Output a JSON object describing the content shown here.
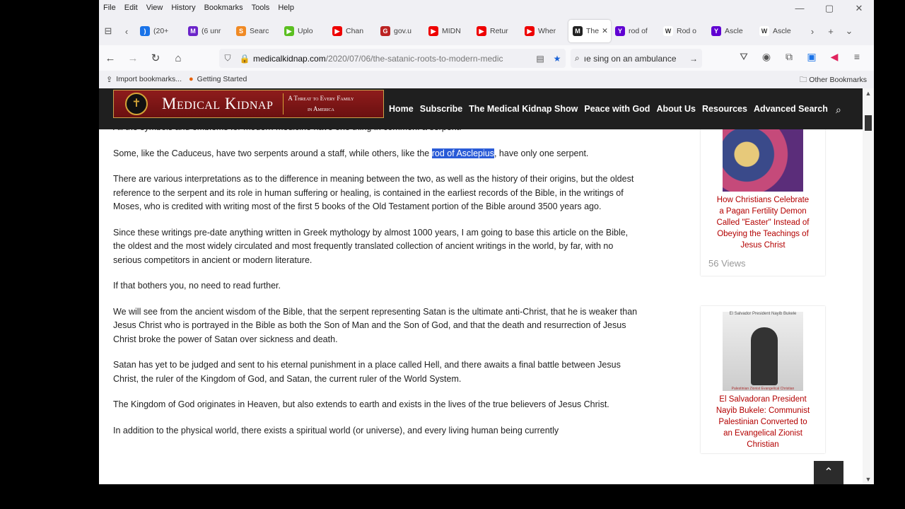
{
  "menu": [
    "File",
    "Edit",
    "View",
    "History",
    "Bookmarks",
    "Tools",
    "Help"
  ],
  "window": {
    "min": "—",
    "max": "▢",
    "close": "✕"
  },
  "tabs": [
    {
      "label": "(20+",
      "fav_color": "#1a73e8",
      "fav_text": ")"
    },
    {
      "label": "(6 unr",
      "fav_color": "#6b24c9",
      "fav_text": "M"
    },
    {
      "label": "Searc",
      "fav_color": "#f08a24",
      "fav_text": "S"
    },
    {
      "label": "Uplo",
      "fav_color": "#5bbf21",
      "fav_text": "▶"
    },
    {
      "label": "Chan",
      "fav_color": "#e00",
      "fav_text": "▶"
    },
    {
      "label": "gov.u",
      "fav_color": "#b22",
      "fav_text": "G"
    },
    {
      "label": "MIDN",
      "fav_color": "#e00",
      "fav_text": "▶"
    },
    {
      "label": "Retur",
      "fav_color": "#e00",
      "fav_text": "▶"
    },
    {
      "label": "Wher",
      "fav_color": "#e00",
      "fav_text": "▶"
    },
    {
      "label": "The",
      "fav_color": "#222",
      "fav_text": "M",
      "active": true
    },
    {
      "label": "rod of",
      "fav_color": "#6001d2",
      "fav_text": "Y"
    },
    {
      "label": "Rod o",
      "fav_color": "#fff",
      "fav_text": "W"
    },
    {
      "label": "Ascle",
      "fav_color": "#6001d2",
      "fav_text": "Y"
    },
    {
      "label": "Ascle",
      "fav_color": "#fff",
      "fav_text": "W"
    }
  ],
  "nav": {
    "url_host": "medicalkidnap.com",
    "url_path": "/2020/07/06/the-satanic-roots-to-modern-medic",
    "search_value": "ıe sing on an ambulance"
  },
  "bookmarks": {
    "import": "Import bookmarks...",
    "getting_started": "Getting Started",
    "other": "Other Bookmarks"
  },
  "site": {
    "logo_title": "Medical Kidnap",
    "logo_tag_1": "A Threat to Every Family",
    "logo_tag_2": "in America",
    "nav": [
      "Home",
      "Subscribe",
      "The Medical Kidnap Show",
      "Peace with God",
      "About Us",
      "Resources",
      "Advanced Search"
    ]
  },
  "article": {
    "p0": "All the symbols and emblems for modern medicine have one thing in common: a serpent.",
    "p1_a": "Some, like the Caduceus, have two serpents around a staff, while others, like the ",
    "p1_hl": "rod of Asclepius",
    "p1_b": ", have only one serpent.",
    "p2": "There are various interpretations as to the difference in meaning between the two, as well as the history of their origins, but the oldest reference to the serpent and its role in human suffering or healing, is contained in the earliest records of the Bible, in the writings of Moses, who is credited with writing most of the first 5 books of the Old Testament portion of the Bible around 3500 years ago.",
    "p3": "Since these writings pre-date anything written in Greek mythology by almost 1000 years, I am going to base this article on the Bible, the oldest and the most widely circulated and most frequently translated collection of ancient writings in the world, by far, with no serious competitors in ancient or modern literature.",
    "p4": "If that bothers you, no need to read further.",
    "p5": "We will see from the ancient wisdom of the Bible, that the serpent representing Satan is the ultimate anti-Christ, that he is weaker than Jesus Christ who is portrayed in the Bible as both the Son of Man and the Son of God, and that the death and resurrection of Jesus Christ broke the power of Satan over sickness and death.",
    "p6": "Satan has yet to be judged and sent to his eternal punishment in a place called Hell, and there awaits a final battle between Jesus Christ, the ruler of the Kingdom of God, and Satan, the current ruler of the World System.",
    "p7": "The Kingdom of God originates in Heaven, but also extends to earth and exists in the lives of the true believers of Jesus Christ.",
    "p8": "In addition to the physical world, there exists a spiritual world (or universe), and every living human being currently"
  },
  "sidebar": {
    "card1_title": "How Christians Celebrate a Pagan Fertility Demon Called \"Easter\" Instead of Obeying the Teachings of Jesus Christ",
    "card1_views": "56 Views",
    "card2_title": "El Salvadoran President Nayib Bukele: Communist Palestinian Converted to an Evangelical Zionist Christian",
    "card2_img_top": "El Salvador President Nayib Bukele",
    "card2_img_bottom": "Palestinian Zionist Evangelical Christian"
  }
}
